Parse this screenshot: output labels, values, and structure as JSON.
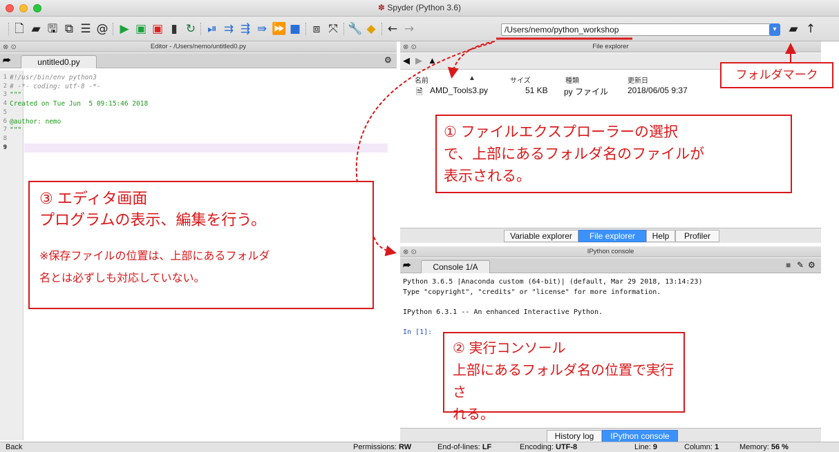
{
  "window": {
    "title": "Spyder (Python 3.6)",
    "title_icon": "spider-icon"
  },
  "toolbar": {
    "path_value": "/Users/nemo/python_workshop",
    "icons": [
      "new-file-icon",
      "open-folder-icon",
      "save-icon",
      "save-all-icon",
      "outline-icon",
      "at-icon",
      "run-icon",
      "run-cell-icon",
      "run-cell-advance-icon",
      "run-selection-icon",
      "rerun-icon",
      "debug-icon",
      "step-icon",
      "step-into-icon",
      "step-return-icon",
      "continue-icon",
      "stop-icon",
      "maximize-pane-icon",
      "fullscreen-icon",
      "wrench-icon",
      "python-path-icon",
      "back-arrow-icon",
      "forward-arrow-icon",
      "browse-folder-icon",
      "up-arrow-icon"
    ]
  },
  "editor": {
    "title": "Editor - /Users/nemo/untitled0.py",
    "tab_label": "untitled0.py",
    "lines": [
      {
        "n": "1",
        "text": "#!/usr/bin/env python3",
        "kind": "cmt"
      },
      {
        "n": "2",
        "text": "# -*- coding: utf-8 -*-",
        "kind": "cmt"
      },
      {
        "n": "3",
        "text": "\"\"\"",
        "kind": "str"
      },
      {
        "n": "4",
        "text": "Created on Tue Jun  5 09:15:46 2018",
        "kind": "str"
      },
      {
        "n": "5",
        "text": "",
        "kind": "str"
      },
      {
        "n": "6",
        "text": "@author: nemo",
        "kind": "str"
      },
      {
        "n": "7",
        "text": "\"\"\"",
        "kind": "str"
      },
      {
        "n": "8",
        "text": "",
        "kind": "str"
      },
      {
        "n": "9",
        "text": "",
        "kind": "str"
      }
    ]
  },
  "file_explorer": {
    "title": "File explorer",
    "columns": [
      "名前",
      "サイズ",
      "種類",
      "更新日"
    ],
    "files": [
      {
        "name": "AMD_Tools3.py",
        "size": "51 KB",
        "type": "py ファイル",
        "date": "2018/06/05 9:37"
      }
    ]
  },
  "upper_tabs": [
    "Variable explorer",
    "File explorer",
    "Help",
    "Profiler"
  ],
  "console": {
    "title": "IPython console",
    "tab_label": "Console 1/A",
    "lines": [
      "Python 3.6.5 |Anaconda custom (64-bit)| (default, Mar 29 2018, 13:14:23)",
      "Type \"copyright\", \"credits\" or \"license\" for more information.",
      "",
      "IPython 6.3.1 -- An enhanced Interactive Python.",
      "",
      "In [1]:"
    ]
  },
  "lower_tabs": [
    "History log",
    "IPython console"
  ],
  "statusbar": {
    "back": "Back",
    "permissions_label": "Permissions:",
    "permissions": "RW",
    "eol_label": "End-of-lines:",
    "eol": "LF",
    "encoding_label": "Encoding:",
    "encoding": "UTF-8",
    "line_label": "Line:",
    "line": "9",
    "column_label": "Column:",
    "column": "1",
    "memory_label": "Memory:",
    "memory": "56 %"
  },
  "annotations": {
    "folder_mark": "フォルダマーク",
    "one": [
      "① ファイルエクスプローラーの選択",
      "で、上部にあるフォルダ名のファイルが",
      "表示される。"
    ],
    "two": [
      "② 実行コンソール",
      "上部にあるフォルダ名の位置で実行さ",
      "れる。"
    ],
    "three": [
      "③ エディタ画面",
      "プログラムの表示、編集を行う。"
    ],
    "three_note": [
      "※保存ファイルの位置は、上部にあるフォルダ",
      "名とは必ずしも対応していない。"
    ]
  },
  "colors": {
    "annotation": "#d9191b",
    "active_tab": "#3b92ff"
  }
}
